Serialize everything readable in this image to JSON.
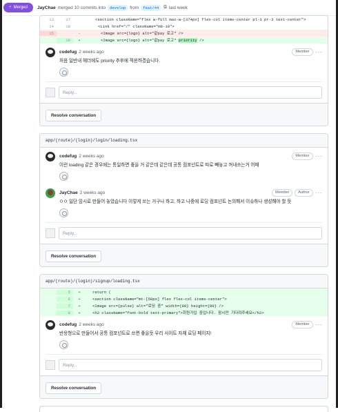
{
  "header": {
    "badge_label": "Merged",
    "author": "JayChae",
    "merge_text": "merged 10 commits into",
    "base_branch": "develop",
    "from_text": "from",
    "head_branch": "feat/44",
    "time_text": "last week"
  },
  "threads": [
    {
      "diff": [
        {
          "old": "13",
          "new": "17",
          "mark": "",
          "type": "ctx",
          "code": "<section className=\"flex w-full max-w-[374px] flex-col items-center pl-3 pr-3 text-center\">"
        },
        {
          "old": "14",
          "new": "18",
          "mark": "",
          "type": "ctx",
          "code": "<Link href=\"/\" className=\"mb-10\">"
        },
        {
          "old": "15",
          "new": "",
          "mark": "-",
          "type": "del",
          "code": "<Image src={logo} alt=\"같pay 로고\" />"
        },
        {
          "old": "",
          "new": "19",
          "mark": "+",
          "type": "add",
          "code_pre": "<Image src={logo} alt=\"같pay 로고\" ",
          "code_hl": "priority",
          "code_post": " />"
        }
      ],
      "comments": [
        {
          "author": "codefug",
          "time": "2 weeks ago",
          "roles": [
            "Member"
          ],
          "text": "처음 일반내 헤더에도 priority 추후에 적용하겠습니다."
        }
      ],
      "reply_placeholder": "Reply...",
      "resolve_label": "Resolve conversation"
    },
    {
      "filepath": "app/(route)/(login)/login/loading.tsx",
      "comments": [
        {
          "author": "codefug",
          "time": "2 weeks ago",
          "roles": [
            "Member"
          ],
          "text": "이런 loading 같은 경우에는 통일하면 좋을 거 같은데 같은데 공통 컴포넌트로 따로 빼놓고 꺼내쓰는거 어때"
        },
        {
          "author": "JayChae",
          "time": "2 weeks ago",
          "roles": [
            "Member",
            "Author"
          ],
          "text": "ㅇㅇ 일단 임시로 만들어 놓았습니다 이렇게 쓰는 거구나 하고, 하고 나중에 로딩 컴포넌트 논의해서 이슈하나 생성해야 할 듯"
        }
      ],
      "reply_placeholder": "Reply...",
      "resolve_label": "Resolve conversation"
    },
    {
      "filepath": "app/(route)/(login)/signup/loading.tsx",
      "diff": [
        {
          "old": "",
          "new": "5",
          "mark": "+",
          "type": "add",
          "code": "return ("
        },
        {
          "old": "",
          "new": "6",
          "mark": "+",
          "type": "add",
          "code": "  <section className=\"mt-[50px] flex flex-col items-center\">"
        },
        {
          "old": "",
          "new": "7",
          "mark": "+",
          "type": "add",
          "code": "    <Image src={pulse} alt=\"로딩 중\" width={80} height={80} />"
        },
        {
          "old": "",
          "new": "8",
          "mark": "+",
          "type": "add",
          "code": "    <h2 className=\"font-bold text-primary\">회원가입 중입니다. 잠시만 기다려주세요</h2>"
        }
      ],
      "comments": [
        {
          "author": "codefug",
          "time": "2 weeks ago",
          "roles": [
            "Member"
          ],
          "text": "반응형으로 만들어서 공통 컴포넌트로 쓰면 좋을듯 우리 사이트 자체 로딩 페이지!"
        }
      ],
      "reply_placeholder": "Reply...",
      "resolve_label": "Resolve conversation"
    }
  ]
}
